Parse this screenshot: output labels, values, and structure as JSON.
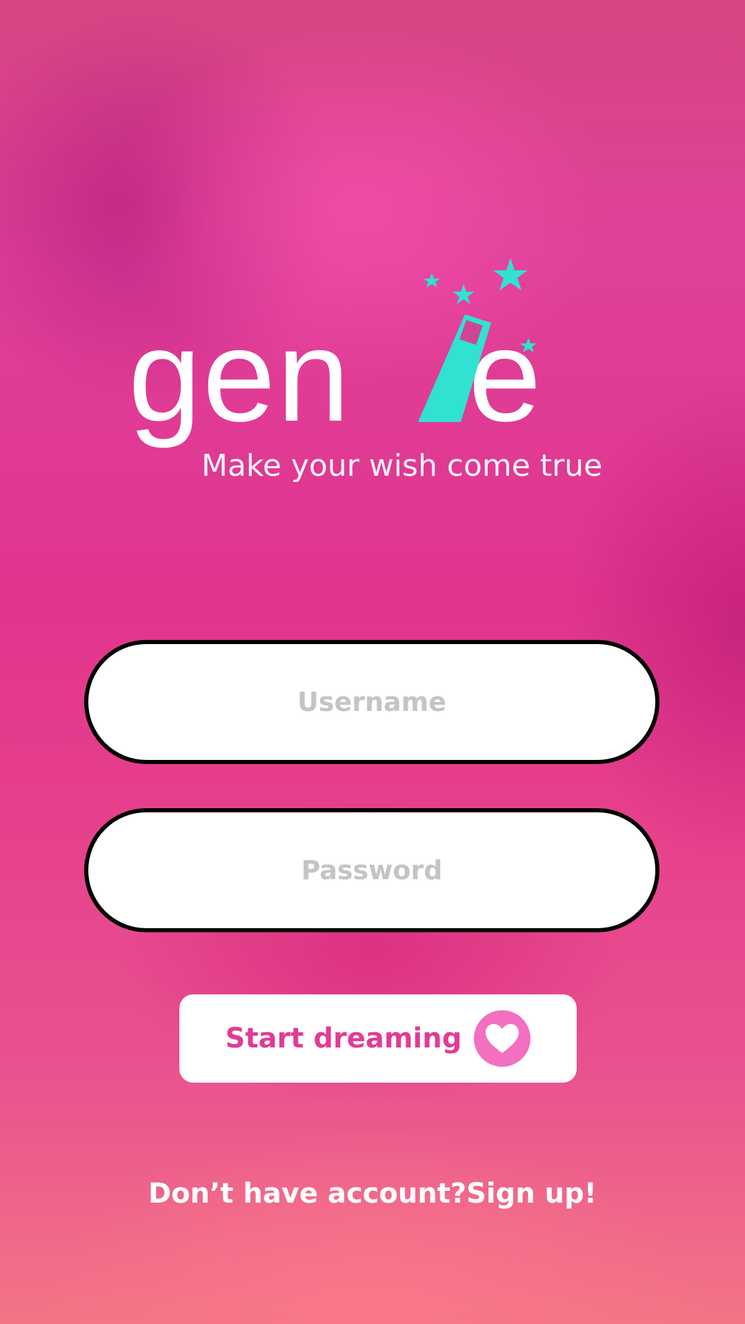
{
  "app": {
    "logo_text": "genie",
    "tagline": "Make your wish come true"
  },
  "form": {
    "username_placeholder": "Username",
    "password_placeholder": "Password",
    "submit_label": "Start dreaming",
    "submit_icon": "heart-icon"
  },
  "footer": {
    "signup_text": "Don’t have account?Sign up!"
  },
  "colors": {
    "accent": "#e23b95",
    "magic": "#2fe2d2",
    "background": "#e0358e"
  }
}
